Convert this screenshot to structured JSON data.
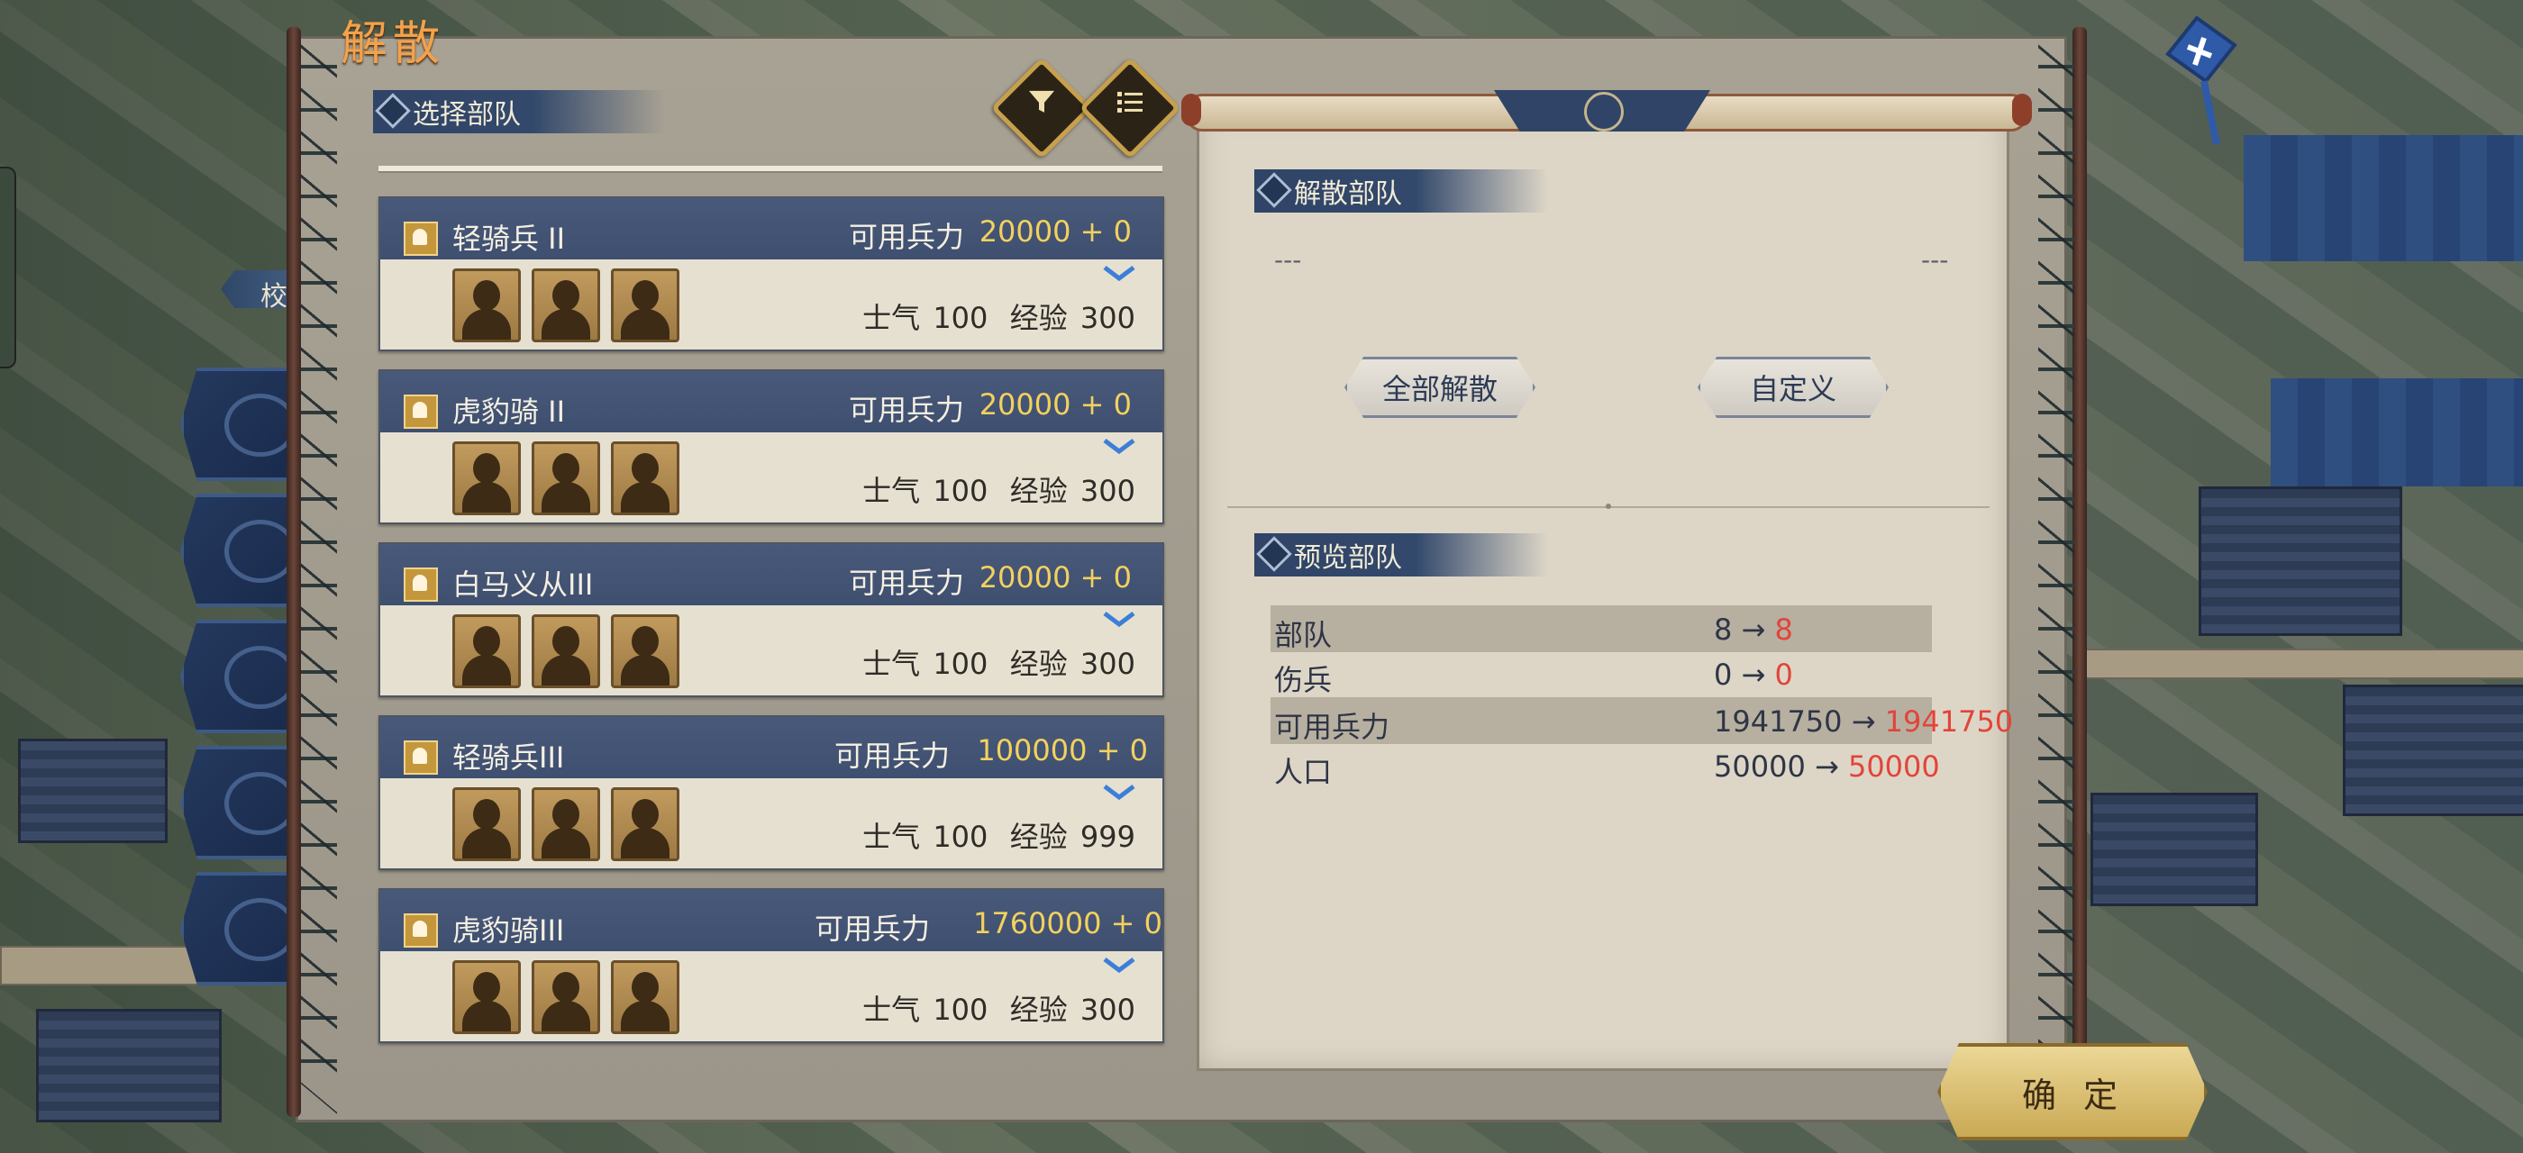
{
  "window_title": "解散",
  "left_section": {
    "label": "选择部队",
    "filter_icon": "funnel-icon",
    "sort_icon": "list-icon"
  },
  "side_tab_label": "校",
  "units": [
    {
      "name": "轻骑兵 II",
      "avail_label": "可用兵力",
      "avail_value": "20000 + 0",
      "morale_label": "士气",
      "morale": "100",
      "exp_label": "经验",
      "exp": "300"
    },
    {
      "name": "虎豹骑 II",
      "avail_label": "可用兵力",
      "avail_value": "20000 + 0",
      "morale_label": "士气",
      "morale": "100",
      "exp_label": "经验",
      "exp": "300"
    },
    {
      "name": "白马义从III",
      "avail_label": "可用兵力",
      "avail_value": "20000 + 0",
      "morale_label": "士气",
      "morale": "100",
      "exp_label": "经验",
      "exp": "300"
    },
    {
      "name": "轻骑兵III",
      "avail_label": "可用兵力",
      "avail_value": "100000 + 0",
      "morale_label": "士气",
      "morale": "100",
      "exp_label": "经验",
      "exp": "999"
    },
    {
      "name": "虎豹骑III",
      "avail_label": "可用兵力",
      "avail_value": "1760000 + 0",
      "morale_label": "士气",
      "morale": "100",
      "exp_label": "经验",
      "exp": "300"
    }
  ],
  "disband": {
    "label": "解散部队",
    "left_placeholder": "---",
    "right_placeholder": "---",
    "all_button": "全部解散",
    "custom_button": "自定义"
  },
  "preview": {
    "label": "预览部队",
    "arrow": "→",
    "rows": [
      {
        "key": "部队",
        "from": "8",
        "to": "8"
      },
      {
        "key": "伤兵",
        "from": "0",
        "to": "0"
      },
      {
        "key": "可用兵力",
        "from": "1941750",
        "to": "1941750"
      },
      {
        "key": "人口",
        "from": "50000",
        "to": "50000"
      }
    ]
  },
  "confirm_button": "确定",
  "colors": {
    "title": "#f2a24a",
    "highlight_value": "#f3d15d",
    "preview_new": "#e2443a",
    "header_blue": "#3e4f70"
  }
}
